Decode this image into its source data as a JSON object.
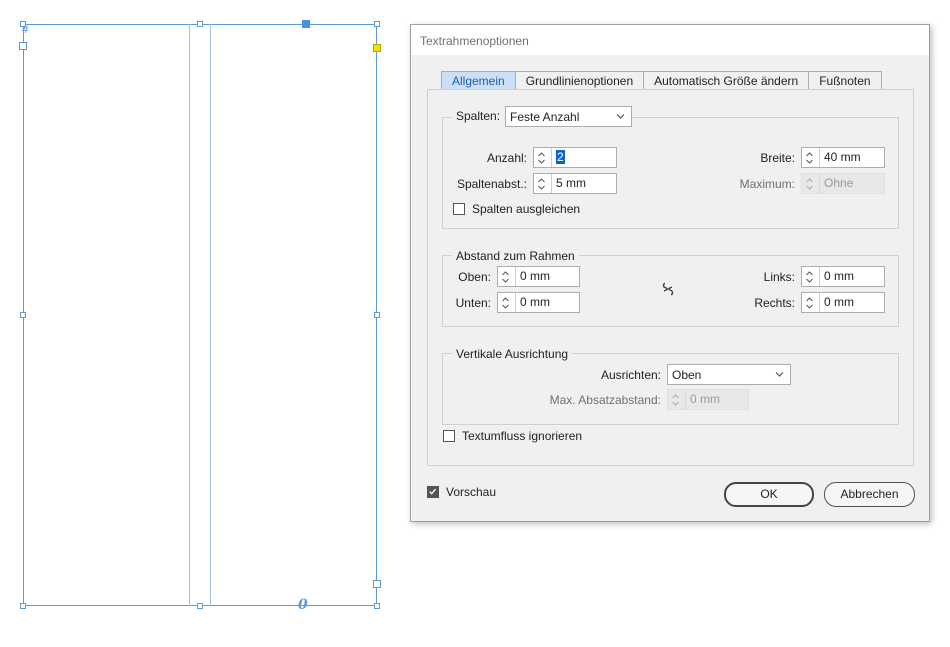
{
  "canvas": {
    "frame_color": "#5b9bd5",
    "overflow_glyph": "#",
    "thread_glyph": "0"
  },
  "dialog": {
    "title": "Textrahmenoptionen",
    "tabs": [
      {
        "label": "Allgemein",
        "active": true
      },
      {
        "label": "Grundlinienoptionen",
        "active": false
      },
      {
        "label": "Automatisch Größe ändern",
        "active": false
      },
      {
        "label": "Fußnoten",
        "active": false
      }
    ],
    "columns": {
      "label": "Spalten:",
      "mode": "Feste Anzahl",
      "anzahl_label": "Anzahl:",
      "anzahl_value": "2",
      "breite_label": "Breite:",
      "breite_value": "40 mm",
      "spaltenabst_label": "Spaltenabst.:",
      "spaltenabst_value": "5 mm",
      "maximum_label": "Maximum:",
      "maximum_value": "Ohne",
      "balance_label": "Spalten ausgleichen",
      "balance_checked": false
    },
    "inset": {
      "legend": "Abstand zum Rahmen",
      "oben_label": "Oben:",
      "oben_value": "0 mm",
      "unten_label": "Unten:",
      "unten_value": "0 mm",
      "links_label": "Links:",
      "links_value": "0 mm",
      "rechts_label": "Rechts:",
      "rechts_value": "0 mm",
      "link_icon": "broken-chain-icon"
    },
    "vertical": {
      "legend": "Vertikale Ausrichtung",
      "ausrichten_label": "Ausrichten:",
      "ausrichten_value": "Oben",
      "max_label": "Max. Absatzabstand:",
      "max_value": "0 mm"
    },
    "ignore_wrap_label": "Textumfluss ignorieren",
    "ignore_wrap_checked": false,
    "preview_label": "Vorschau",
    "preview_checked": true,
    "ok_label": "OK",
    "cancel_label": "Abbrechen",
    "accent_color": "#1a5fb4"
  }
}
